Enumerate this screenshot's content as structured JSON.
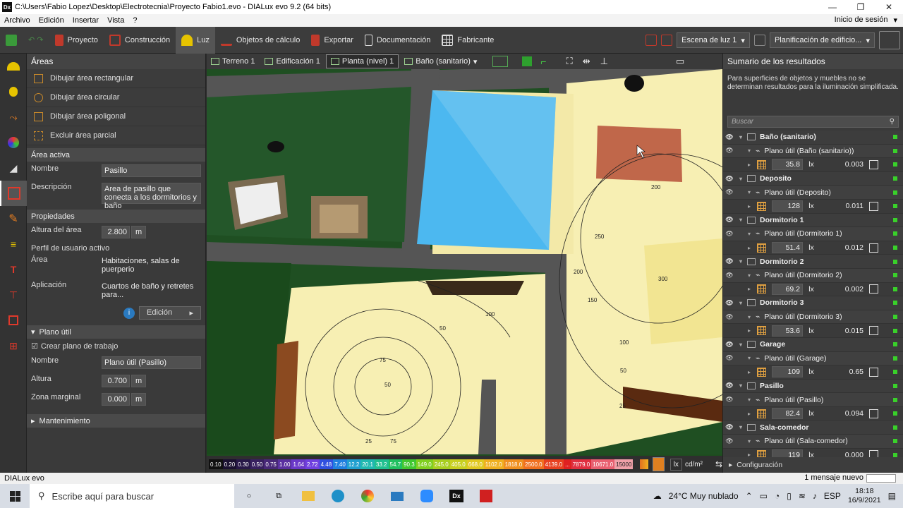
{
  "window": {
    "title": "C:\\Users\\Fabio Lopez\\Desktop\\Electrotecnia\\Proyecto Fabio1.evo - DIALux evo 9.2  (64 bits)",
    "app_icon": "Dx"
  },
  "menu": {
    "items": [
      "Archivo",
      "Edición",
      "Insertar",
      "Vista",
      "?"
    ],
    "login": "Inicio de sesión"
  },
  "toolbar": {
    "buttons": [
      {
        "label": "Proyecto"
      },
      {
        "label": "Construcción"
      },
      {
        "label": "Luz"
      },
      {
        "label": "Objetos de cálculo"
      },
      {
        "label": "Exportar"
      },
      {
        "label": "Documentación"
      },
      {
        "label": "Fabricante"
      }
    ],
    "scene_dropdown": "Escena de luz 1",
    "planning_dropdown": "Planificación de edificio..."
  },
  "left_panel": {
    "title": "Áreas",
    "draw_items": [
      "Dibujar área rectangular",
      "Dibujar área circular",
      "Dibujar área poligonal",
      "Excluir área parcial"
    ],
    "active_area": {
      "section": "Área activa",
      "name_label": "Nombre",
      "name_value": "Pasillo",
      "desc_label": "Descripción",
      "desc_value": "Area de pasillo que conecta a los dormitorios y baño"
    },
    "properties": {
      "section": "Propiedades",
      "height_label": "Altura del área",
      "height_value": "2.800",
      "height_unit": "m",
      "profile_label": "Perfil de usuario activo",
      "area_label": "Área",
      "area_value": "Habitaciones, salas de puerperio",
      "app_label": "Aplicación",
      "app_value": "Cuartos de baño y retretes para...",
      "edit_button": "Edición"
    },
    "workplane": {
      "section": "Plano útil",
      "create_label": "Crear plano de trabajo",
      "name_label": "Nombre",
      "name_value": "Plano útil (Pasillo)",
      "height_label": "Altura",
      "height_value": "0.700",
      "height_unit": "m",
      "margin_label": "Zona marginal",
      "margin_value": "0.000",
      "margin_unit": "m"
    },
    "maintenance": "Mantenimiento"
  },
  "viewport": {
    "tabs": [
      "Terreno 1",
      "Edificación 1",
      "Planta (nivel) 1",
      "Baño (sanitario)"
    ],
    "contour_labels": [
      "50",
      "75",
      "50",
      "75",
      "25",
      "100",
      "200",
      "250",
      "300",
      "200",
      "150",
      "100",
      "50",
      "25"
    ],
    "legend": [
      "0.10",
      "0.20",
      "0.30",
      "0.50",
      "0.75",
      "1.00",
      "1.64",
      "2.72",
      "4.48",
      "7.40",
      "12.2",
      "20.1",
      "33.2",
      "54.7",
      "90.3",
      "149.0",
      "245.0",
      "405.0",
      "668.0",
      "1102.0",
      "1818.0",
      "2500.0",
      "4139.0",
      "...",
      "7879.0",
      "10671.0",
      "15000"
    ],
    "unit_lx": "lx",
    "unit_cd": "cd/m²"
  },
  "right_panel": {
    "title": "Sumario de los resultados",
    "note": "Para superficies de objetos y muebles no se determinan resultados para la iluminación simplificada.",
    "search_placeholder": "Buscar",
    "rooms": [
      {
        "name": "Baño (sanitario)",
        "plane": "Plano útil (Baño (sanitario))",
        "value": "35.8",
        "unit": "lx",
        "ratio": "0.003"
      },
      {
        "name": "Deposito",
        "plane": "Plano útil (Deposito)",
        "value": "128",
        "unit": "lx",
        "ratio": "0.011"
      },
      {
        "name": "Dormitorio 1",
        "plane": "Plano útil (Dormitorio 1)",
        "value": "51.4",
        "unit": "lx",
        "ratio": "0.012"
      },
      {
        "name": "Dormitorio 2",
        "plane": "Plano útil (Dormitorio 2)",
        "value": "69.2",
        "unit": "lx",
        "ratio": "0.002"
      },
      {
        "name": "Dormitorio 3",
        "plane": "Plano útil (Dormitorio 3)",
        "value": "53.6",
        "unit": "lx",
        "ratio": "0.015"
      },
      {
        "name": "Garage",
        "plane": "Plano útil (Garage)",
        "value": "109",
        "unit": "lx",
        "ratio": "0.65"
      },
      {
        "name": "Pasillo",
        "plane": "Plano útil (Pasillo)",
        "value": "82.4",
        "unit": "lx",
        "ratio": "0.094"
      },
      {
        "name": "Sala-comedor",
        "plane": "Plano útil (Sala-comedor)",
        "value": "119",
        "unit": "lx",
        "ratio": "0.000"
      }
    ],
    "config": "Configuración"
  },
  "status": {
    "app": "DIALux evo",
    "message": "1 mensaje nuevo"
  },
  "taskbar": {
    "search_placeholder": "Escribe aquí para buscar",
    "weather": "24°C  Muy nublado",
    "lang": "ESP",
    "time": "18:18",
    "date": "16/9/2021"
  },
  "colors": {
    "accent_green": "#39d12a",
    "ui_dark": "#3a3a3a",
    "pool_blue": "#4cb8f0",
    "floor_yellow": "#f7efb3"
  }
}
